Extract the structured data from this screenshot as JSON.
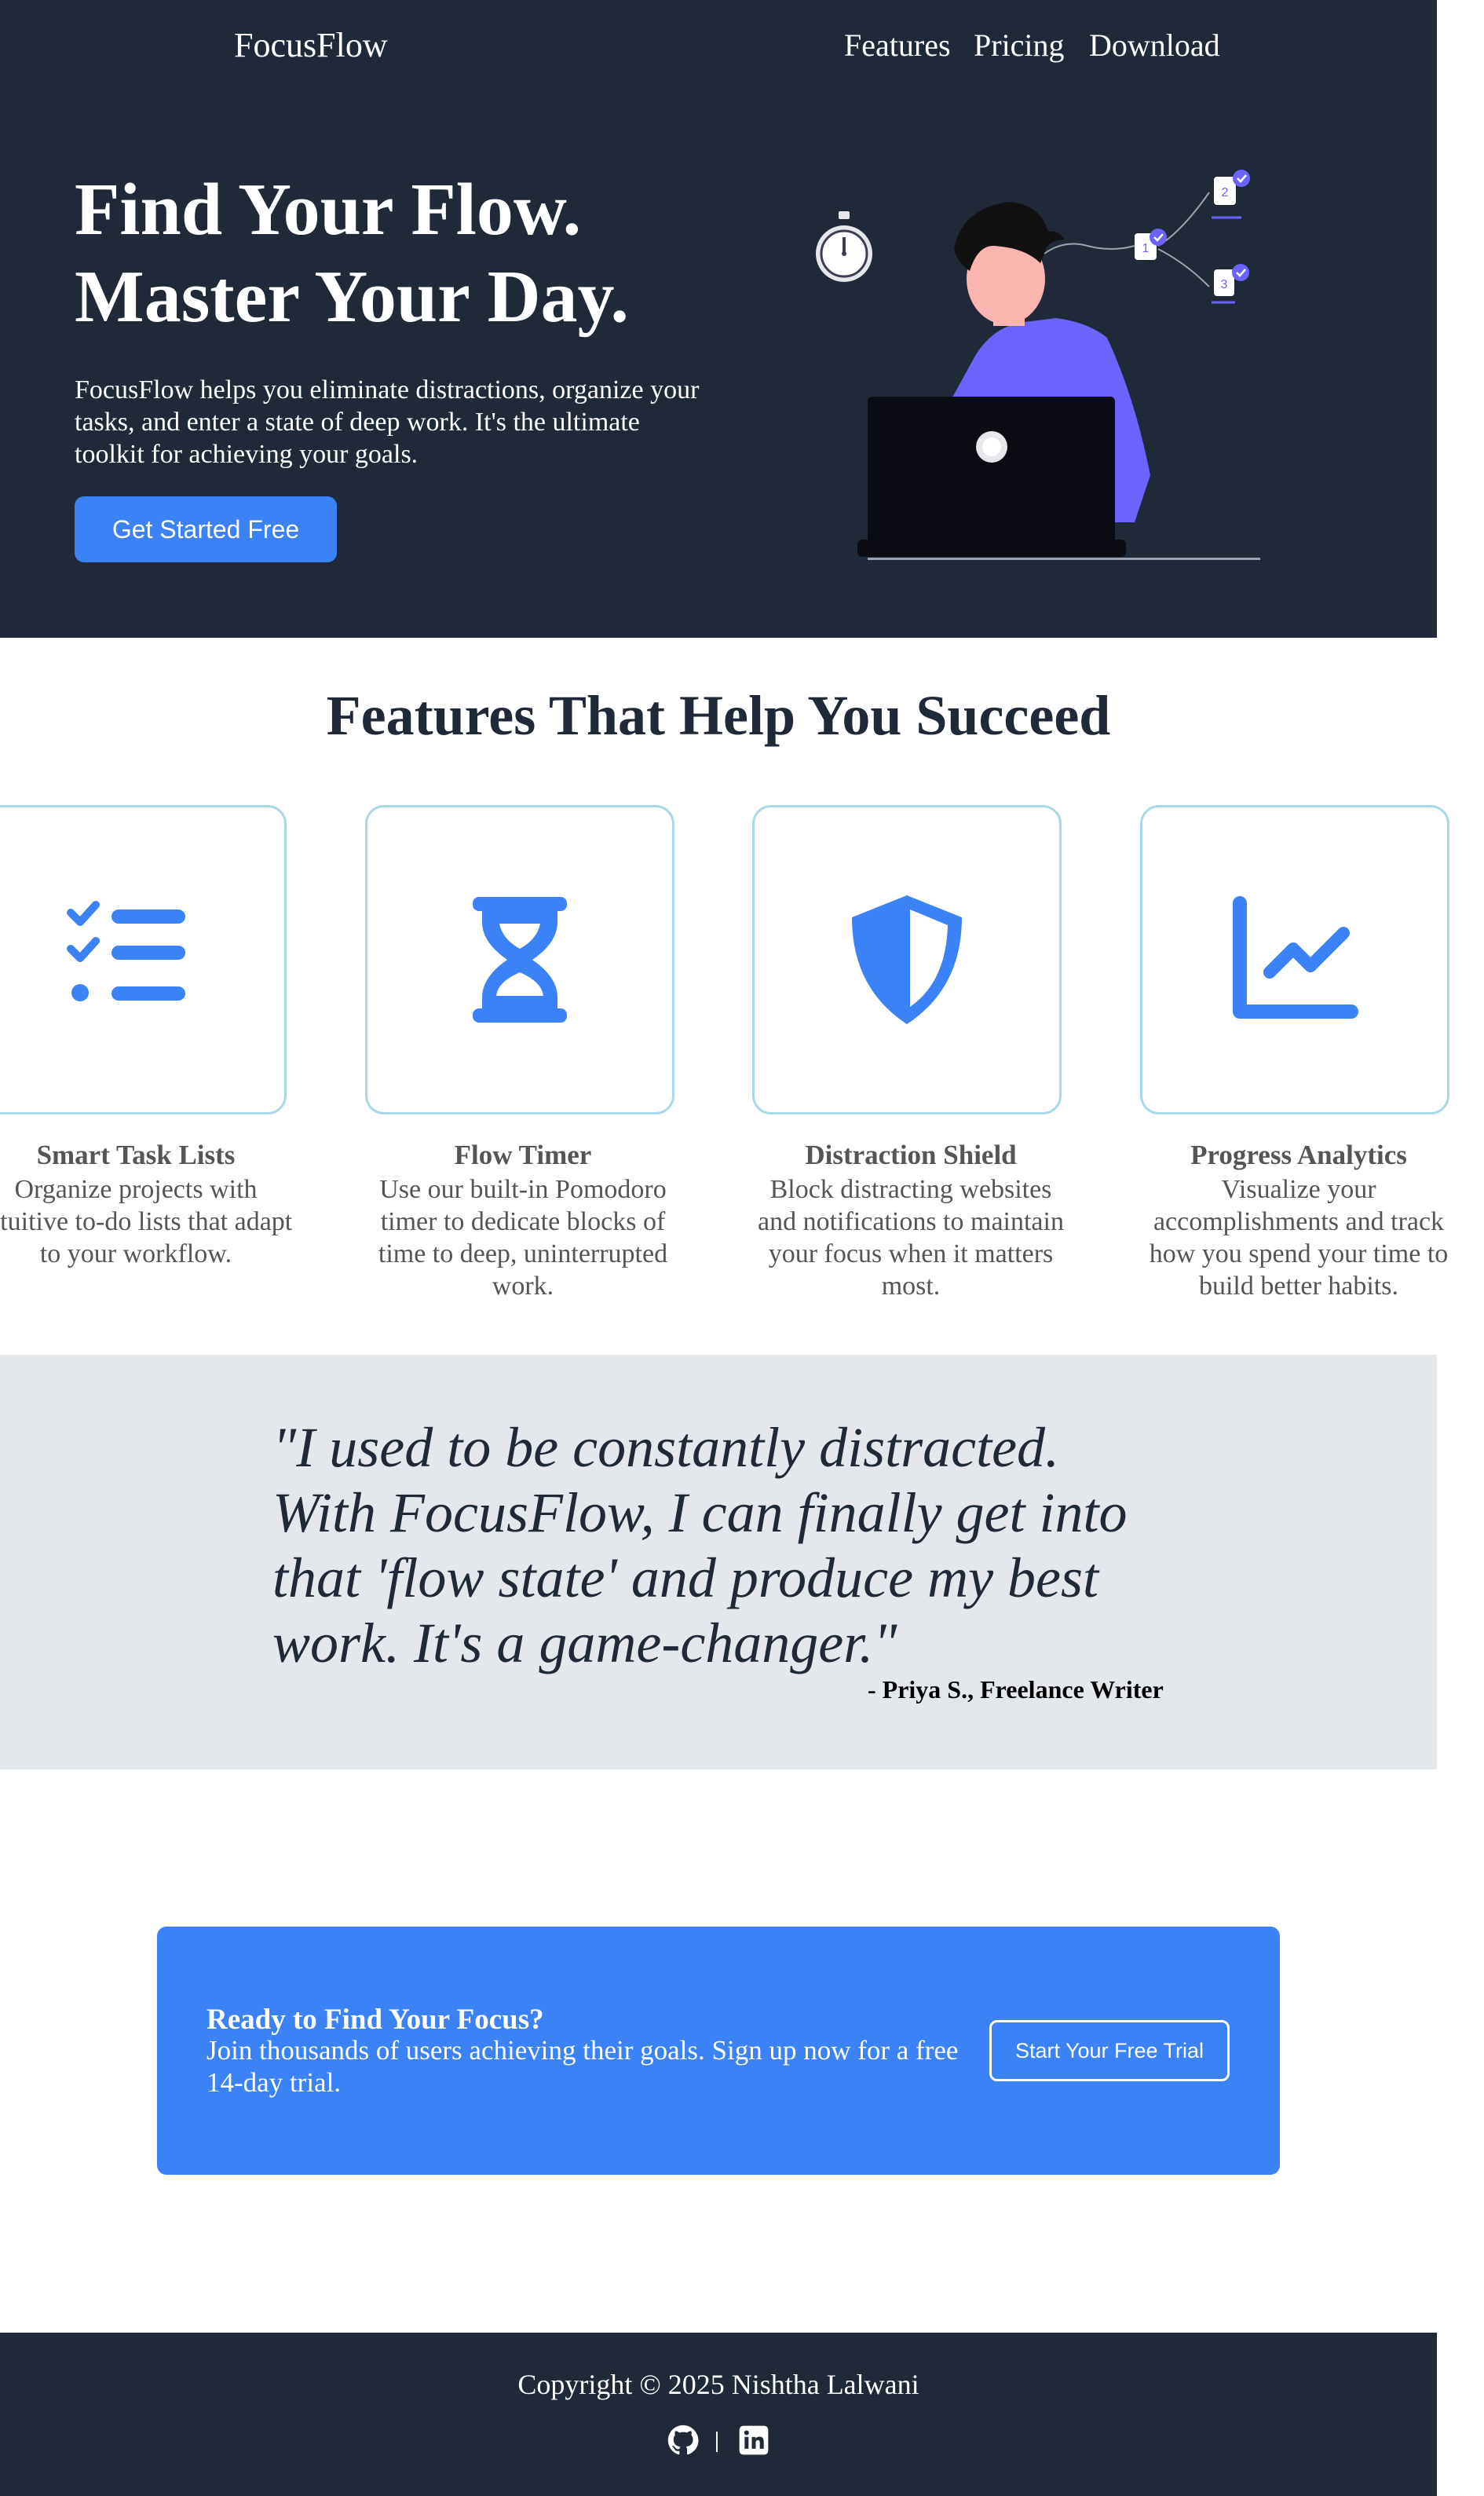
{
  "header": {
    "brand": "FocusFlow",
    "nav": [
      "Features",
      "Pricing",
      "Download"
    ]
  },
  "hero": {
    "title_line1": "Find Your Flow.",
    "title_line2": "Master Your Day.",
    "description": "FocusFlow helps you eliminate distractions, organize your tasks, and enter a state of deep work. It's the ultimate toolkit for achieving your goals.",
    "cta_label": "Get Started Free",
    "illustration_badges": [
      "1",
      "2",
      "3"
    ]
  },
  "features": {
    "heading": "Features That Help You Succeed",
    "items": [
      {
        "icon": "task-list-icon",
        "title": "Smart Task Lists",
        "description": "Organize projects with intuitive to-do lists that adapt to your workflow."
      },
      {
        "icon": "hourglass-icon",
        "title": "Flow Timer",
        "description": "Use our built-in Pomodoro timer to dedicate blocks of time to deep, uninterrupted work."
      },
      {
        "icon": "shield-icon",
        "title": "Distraction Shield",
        "description": "Block distracting websites and notifications to maintain your focus when it matters most."
      },
      {
        "icon": "chart-line-icon",
        "title": "Progress Analytics",
        "description": "Visualize your accomplishments and track how you spend your time to build better habits."
      }
    ]
  },
  "testimonial": {
    "quote": "\"I used to be constantly distracted. With FocusFlow, I can finally get into that 'flow state' and produce my best work. It's a game-changer.\"",
    "author": "- Priya S., Freelance Writer"
  },
  "signup": {
    "title": "Ready to Find Your Focus?",
    "text": "Join thousands of users achieving their goals. Sign up now for a free 14-day trial.",
    "button_label": "Start Your Free Trial"
  },
  "footer": {
    "copyright": "Copyright © 2025 Nishtha Lalwani",
    "separator": "|",
    "icons": [
      "github-icon",
      "linkedin-icon"
    ]
  },
  "colors": {
    "dark": "#1f2937",
    "accent": "#3b82f6",
    "illustration_purple": "#6c63ff",
    "testimonial_bg": "#e4e7eb",
    "card_border": "#a9d8e6"
  }
}
